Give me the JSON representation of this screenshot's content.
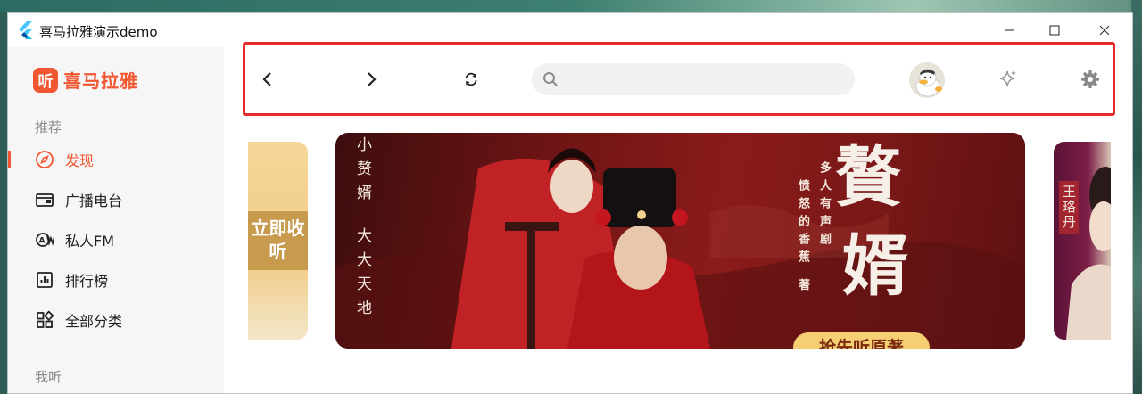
{
  "window": {
    "title": "喜马拉雅演示demo"
  },
  "sidebar": {
    "brand_badge": "听",
    "brand_name": "喜马拉雅",
    "sections": [
      {
        "title": "推荐"
      },
      {
        "title": "我听"
      }
    ],
    "items": [
      {
        "label": "发现",
        "icon": "compass-icon",
        "active": true
      },
      {
        "label": "广播电台",
        "icon": "radio-icon",
        "active": false
      },
      {
        "label": "私人FM",
        "icon": "fm-icon",
        "active": false
      },
      {
        "label": "排行榜",
        "icon": "chart-icon",
        "active": false
      },
      {
        "label": "全部分类",
        "icon": "category-grid-icon",
        "active": false
      }
    ]
  },
  "toolbar": {
    "search": {
      "value": "",
      "placeholder": ""
    }
  },
  "carousel": {
    "left_banner_text": "立即收听",
    "main_banner": {
      "left_vertical_1": "小赘婿",
      "left_vertical_2": "大大天地",
      "subtitle_1": "多人有声剧",
      "subtitle_2": "愤怒的香蕉 著",
      "title_line_1": "贅",
      "title_line_2": "婿",
      "cta": "抢先听原著"
    },
    "right_banner_text": "王珞丹"
  },
  "colors": {
    "accent": "#f25733",
    "highlight_border": "#e52b2b"
  }
}
